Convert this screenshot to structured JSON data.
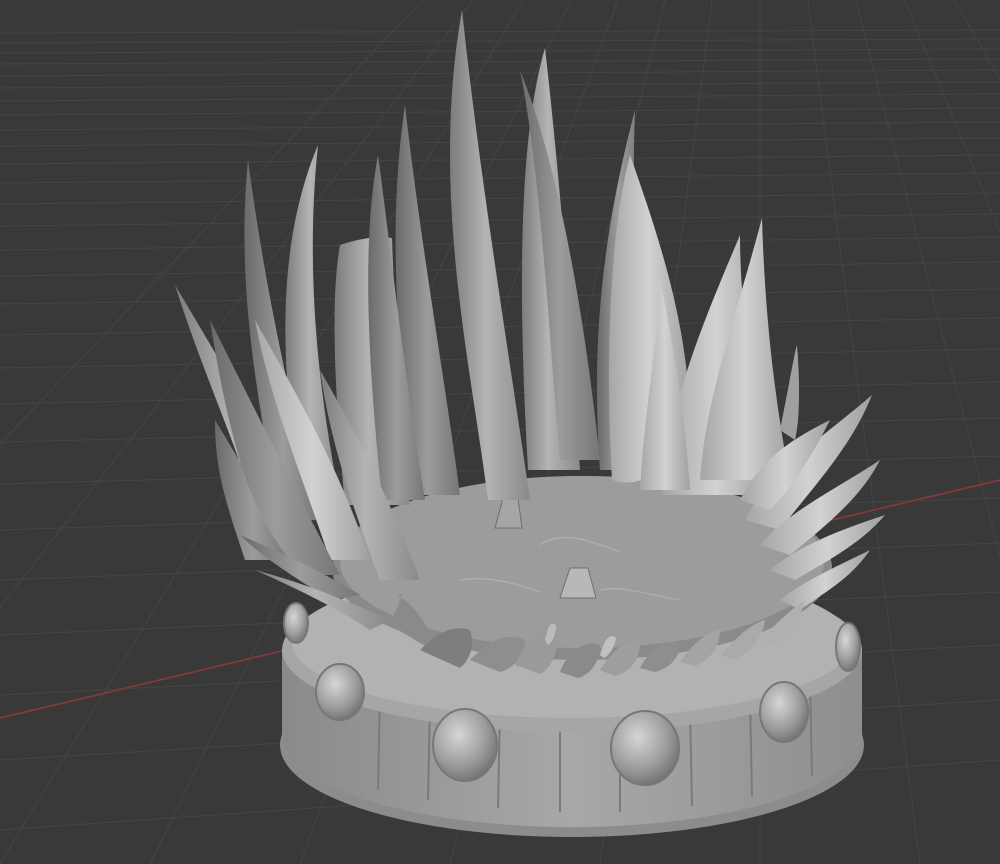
{
  "viewport": {
    "background": "#393939",
    "grid_color": "#454545",
    "x_axis_color": "#8a3a3a",
    "model": "spiky-crown-sculpt",
    "material_color": "#9a9a9a",
    "shading": "solid"
  }
}
